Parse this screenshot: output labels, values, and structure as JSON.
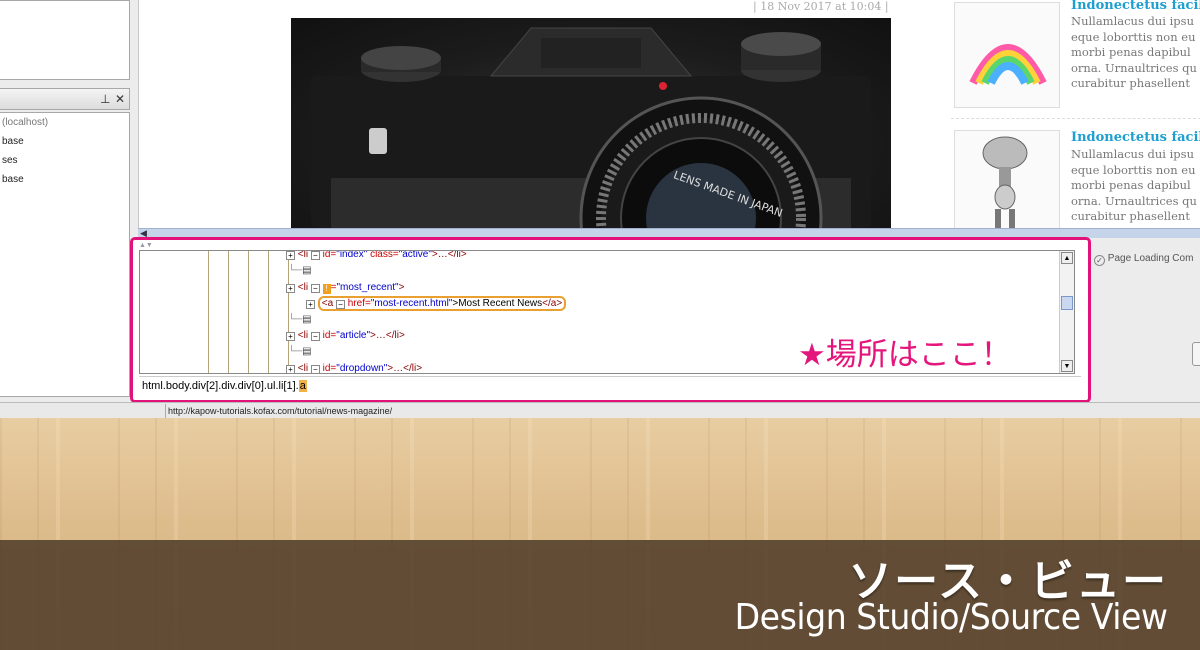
{
  "left_panel": {
    "tree_items": [
      "(localhost)",
      "base",
      "ses",
      "base"
    ]
  },
  "browser": {
    "post_date": "| 18 Nov 2017 at 10:04 |",
    "sidebar_posts": [
      {
        "title": "Indonectetus facil",
        "lines": [
          "Nullamlacus dui ipsu",
          "eque loborttis non eu",
          "morbi penas dapibul",
          "orna. Urnaultrices qu",
          "curabitur phasellent"
        ]
      },
      {
        "title": "Indonectetus facil",
        "lines": [
          "Nullamlacus dui ipsu",
          "eque loborttis non eu",
          "morbi penas dapibul",
          "orna. Urnaultrices qu",
          "curabitur phasellent"
        ]
      }
    ]
  },
  "source_view": {
    "rows": [
      {
        "expander": "+",
        "tag": "<li",
        "id_label": "id=",
        "id_val": "\"index\"",
        "extra_attr": "class=",
        "extra_val": "\"active\"",
        "rest": ">…</li>"
      },
      {
        "doc": "true"
      },
      {
        "expander": "+",
        "tag": "<li",
        "id_label": "=",
        "id_val": "\"most_recent\"",
        "rest": ">"
      },
      {
        "expander": "+",
        "tag": "<a",
        "attr": "href=",
        "val": "\"most-recent.html\"",
        "text": ">Most Recent News",
        "close": "</a>"
      },
      {
        "doc": "true"
      },
      {
        "expander": "+",
        "tag": "<li",
        "id_label": "id=",
        "id_val": "\"article\"",
        "rest": ">…</li>"
      },
      {
        "doc": "true"
      },
      {
        "expander": "+",
        "tag": "<li",
        "id_label": "id=",
        "id_val": "\"dropdown\"",
        "rest": ">…</li>"
      }
    ],
    "annotation": "★場所はここ！",
    "path_prefix": "html.body.div[2].div.div[0].ul.li[1].",
    "path_last": "a"
  },
  "right_status": "Page Loading Com",
  "status_url": "http://kapow-tutorials.kofax.com/tutorial/news-magazine/",
  "caption": {
    "japanese": "ソース・ビュー",
    "english": "Design Studio/Source View"
  },
  "colors": {
    "highlight_border": "#e2127a",
    "selection_border": "#e9a030",
    "link_title": "#1e9fd0"
  }
}
